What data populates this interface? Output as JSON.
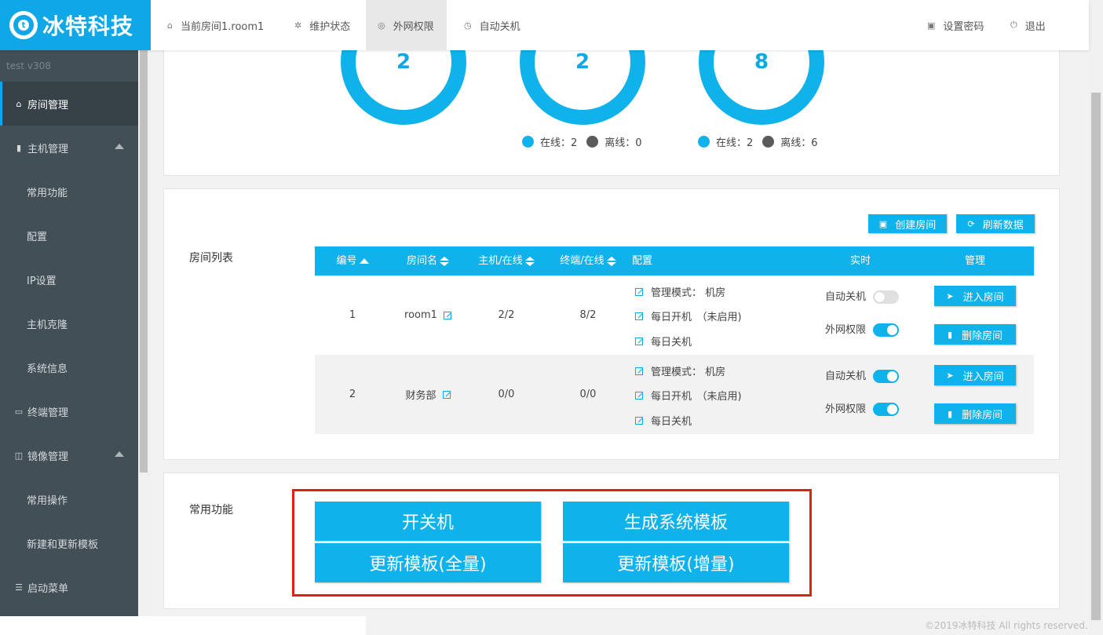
{
  "header": {
    "logo_text": "冰特科技",
    "logo_mark": "t",
    "nav": [
      {
        "label": "当前房间1.room1",
        "icon": "home-icon"
      },
      {
        "label": "维护状态",
        "icon": "tools-icon"
      },
      {
        "label": "外网权限",
        "icon": "globe-icon"
      },
      {
        "label": "自动关机",
        "icon": "clock-icon"
      }
    ],
    "set_password": "设置密码",
    "logout": "退出"
  },
  "sidebar": {
    "version": "test  v308",
    "items": [
      {
        "label": "房间管理",
        "icon": "home-icon",
        "active": true
      },
      {
        "label": "主机管理",
        "icon": "server-icon",
        "expandable": true
      },
      {
        "label": "常用功能",
        "sub": true
      },
      {
        "label": "配置",
        "sub": true
      },
      {
        "label": "IP设置",
        "sub": true
      },
      {
        "label": "主机克隆",
        "sub": true
      },
      {
        "label": "系统信息",
        "sub": true
      },
      {
        "label": "终端管理",
        "icon": "monitor-icon"
      },
      {
        "label": "镜像管理",
        "icon": "database-icon",
        "expandable": true
      },
      {
        "label": "常用操作",
        "sub": true
      },
      {
        "label": "新建和更新模板",
        "sub": true
      },
      {
        "label": "启动菜单",
        "icon": "list-icon"
      }
    ]
  },
  "stats": {
    "donuts": [
      "2",
      "2",
      "8"
    ],
    "legend_hosts": {
      "online": "在线：2",
      "offline": "离线：0"
    },
    "legend_terminals": {
      "online": "在线：2",
      "offline": "离线：6"
    }
  },
  "room_list": {
    "title": "房间列表",
    "create_button": "创建房间",
    "refresh_button": "刷新数据",
    "columns": [
      "编号",
      "房间名",
      "主机/在线",
      "终端/在线",
      "配置",
      "实时",
      "管理"
    ],
    "rows": [
      {
        "id": "1",
        "name": "room1",
        "hosts": "2/2",
        "terminals": "8/2",
        "config": [
          "管理模式： 机房",
          "每日开机　（未启用)",
          "每日关机"
        ],
        "auto_shutdown_label": "自动关机",
        "auto_shutdown": false,
        "internet_label": "外网权限",
        "internet": true,
        "enter": "进入房间",
        "delete": "删除房间"
      },
      {
        "id": "2",
        "name": "财务部",
        "hosts": "0/0",
        "terminals": "0/0",
        "config": [
          "管理模式： 机房",
          "每日开机　（未启用)",
          "每日关机"
        ],
        "auto_shutdown_label": "自动关机",
        "auto_shutdown": true,
        "internet_label": "外网权限",
        "internet": true,
        "enter": "进入房间",
        "delete": "删除房间"
      }
    ]
  },
  "features": {
    "title": "常用功能",
    "buttons": [
      "开关机",
      "生成系统模板",
      "更新模板(全量)",
      "更新模板(增量)"
    ]
  },
  "footer": "©2019冰特科技 All rights reserved.",
  "colors": {
    "accent": "#0fb2ea",
    "sidebar": "#424f57",
    "highlight": "#d9221c"
  }
}
